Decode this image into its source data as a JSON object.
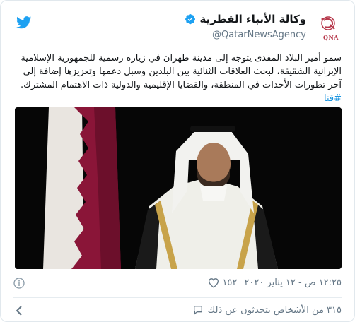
{
  "account": {
    "display_name": "وكالة الأنباء القطرية",
    "handle": "@QatarNewsAgency",
    "logo_text": "QNA",
    "verified": true
  },
  "tweet": {
    "text": "سمو أمير البلاد المفدى يتوجه إلى مدينة طهران في زيارة رسمية للجمهورية الإسلامية الإيرانية الشقيقة، لبحث العلاقات الثنائية بين البلدين وسبل دعمها وتعزيزها إضافة إلى آخر تطورات الأحداث في المنطقة، والقضايا الإقليمية والدولية ذات الاهتمام المشترك. ",
    "hashtag": "#قنا"
  },
  "meta": {
    "like_count": "١٥٢",
    "timestamp": "١٢:٢٥ ص - ١٢ يناير ٢٠٢٠"
  },
  "footer": {
    "people_talking": "٣١٥ من الأشخاص يتحدثون عن ذلك"
  },
  "icons": {
    "bird": "twitter-bird-icon",
    "verified": "verified-badge-icon",
    "heart": "heart-icon",
    "info": "info-icon",
    "chat": "chat-bubble-icon",
    "chevron": "chevron-left-icon"
  },
  "colors": {
    "twitter_blue": "#1da1f2",
    "link_blue": "#1b95e0",
    "muted": "#657786",
    "qatar_maroon": "#8a1538"
  }
}
